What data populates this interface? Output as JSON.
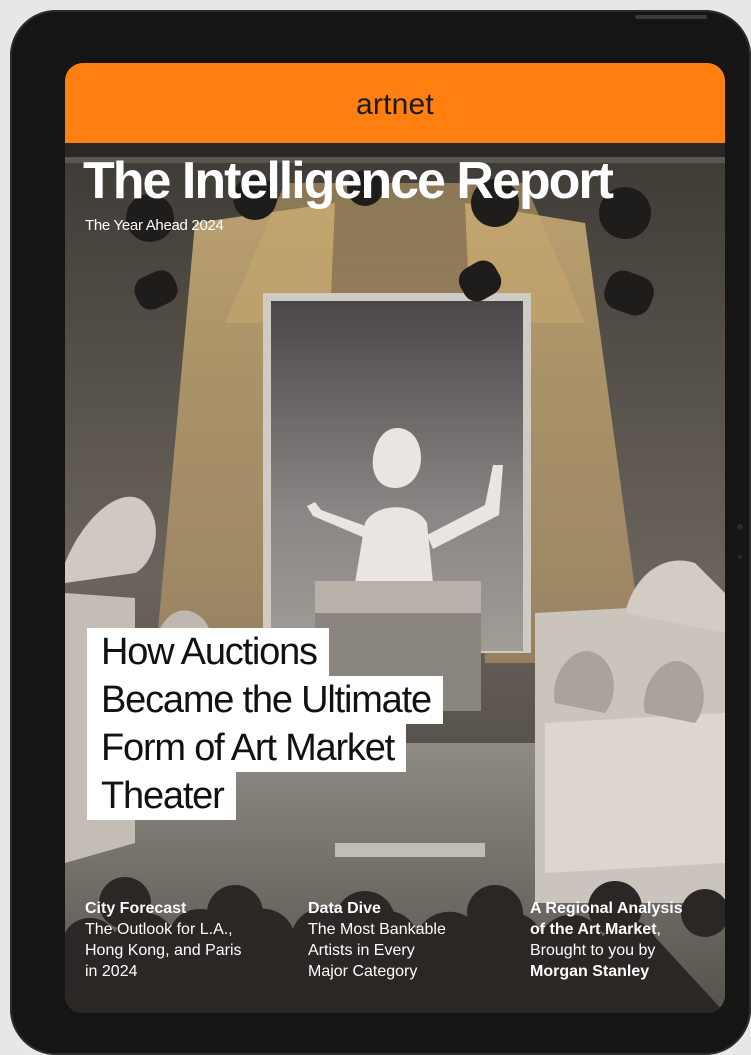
{
  "header": {
    "brand": "artnet",
    "accent_color": "#ff7f11"
  },
  "cover": {
    "title": "The Intelligence Report",
    "subtitle": "The Year Ahead 2024",
    "headline_lines": [
      "How Auctions",
      "Became the Ultimate",
      "Form of Art Market",
      "Theater"
    ],
    "features": [
      {
        "title": "City Forecast",
        "lines": [
          "The Outlook for L.A.,",
          "Hong Kong, and Paris",
          "in 2024"
        ]
      },
      {
        "title": "Data Dive",
        "lines": [
          "The Most Bankable",
          "Artists in Every",
          "Major Category"
        ]
      },
      {
        "title": "A Regional Analysis",
        "title2": "of the Art Market",
        "line2_suffix": ",",
        "line3": "Brought to you by",
        "sponsor": "Morgan Stanley"
      }
    ]
  }
}
